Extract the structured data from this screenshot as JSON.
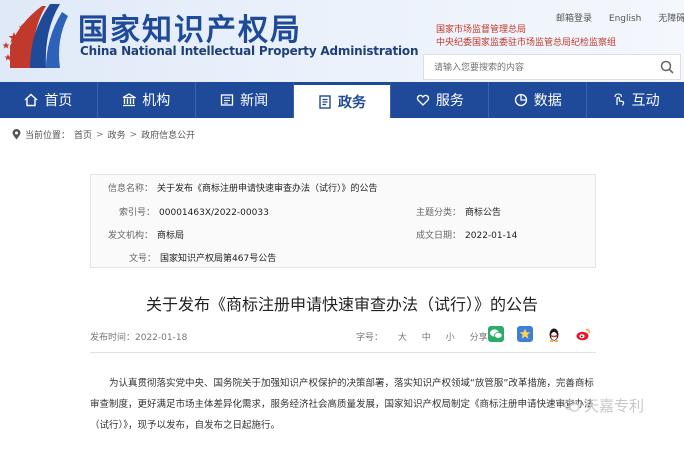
{
  "header": {
    "title_cn": "国家知识产权局",
    "title_en": "China National Intellectual Property Administration",
    "dept_line1": "国家市场监督管理总局",
    "dept_line2": "中央纪委国家监委驻市场监管总局纪检监察组",
    "links": [
      "邮箱登录",
      "English",
      "无障碍"
    ],
    "search_placeholder": "请输入您要搜索的内容"
  },
  "nav": [
    {
      "label": "首页",
      "icon": "home-icon"
    },
    {
      "label": "机构",
      "icon": "institution-icon"
    },
    {
      "label": "新闻",
      "icon": "news-icon"
    },
    {
      "label": "政务",
      "icon": "document-icon",
      "active": true
    },
    {
      "label": "服务",
      "icon": "heart-hand-icon"
    },
    {
      "label": "数据",
      "icon": "pie-chart-icon"
    },
    {
      "label": "互动",
      "icon": "interaction-icon"
    }
  ],
  "breadcrumb": {
    "prefix": "当前位置：",
    "items": [
      "首页",
      "政务",
      "政府信息公开"
    ],
    "sep": ">"
  },
  "meta": {
    "info_name_label": "信息名称：",
    "info_name_value": "关于发布《商标注册申请快速审查办法（试行）》的公告",
    "index_label": "索引号：",
    "index_value": "00001463X/2022-00033",
    "topic_label": "主题分类：",
    "topic_value": "商标公告",
    "issuer_label": "发文机构：",
    "issuer_value": "商标局",
    "date_label": "成文日期：",
    "date_value": "2022-01-14",
    "docno_label": "文号：",
    "docno_value": "国家知识产权局第467号公告"
  },
  "article": {
    "title": "关于发布《商标注册申请快速审查办法（试行）》的公告",
    "pub_date": "发布时间：2022-01-18",
    "font_size_label": "字号：",
    "font_sizes": [
      "大",
      "中",
      "小"
    ],
    "share_label": "分享：",
    "body": "为认真贯彻落实党中央、国务院关于加强知识产权保护的决策部署，落实知识产权领域“放管服”改革措施，完善商标审查制度，更好满足市场主体差异化需求，服务经济社会高质量发展，国家知识产权局制定《商标注册申请快速审查办法（试行）》，现予以发布，自发布之日起施行。"
  },
  "watermark": "天嘉专利",
  "colors": {
    "primary": "#1f4a9a",
    "accent_red": "#c0392b"
  }
}
